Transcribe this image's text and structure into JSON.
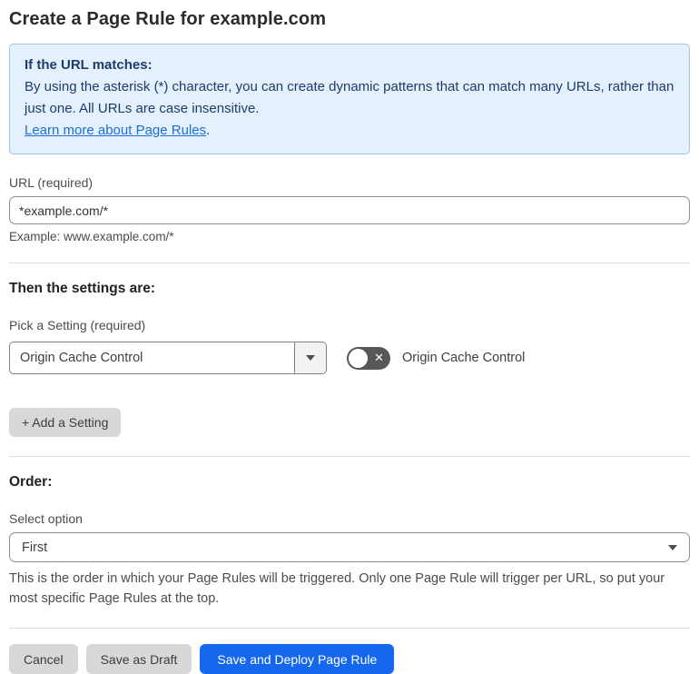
{
  "page": {
    "title": "Create a Page Rule for example.com"
  },
  "info_box": {
    "heading": "If the URL matches:",
    "body": "By using the asterisk (*) character, you can create dynamic patterns that can match many URLs, rather than just one. All URLs are case insensitive.",
    "link_label": "Learn more about Page Rules",
    "link_suffix": "."
  },
  "url_field": {
    "label": "URL (required)",
    "value": "*example.com/*",
    "example": "Example: www.example.com/*"
  },
  "settings_section": {
    "heading": "Then the settings are:",
    "picker_label": "Pick a Setting (required)",
    "picker_value": "Origin Cache Control",
    "toggle_label": "Origin Cache Control",
    "toggle_state": "off",
    "toggle_glyph": "✕",
    "add_setting_label": "+ Add a Setting"
  },
  "order_section": {
    "heading": "Order:",
    "select_label": "Select option",
    "select_value": "First",
    "help_text": "This is the order in which your Page Rules will be triggered. Only one Page Rule will trigger per URL, so put your most specific Page Rules at the top."
  },
  "footer": {
    "cancel_label": "Cancel",
    "save_draft_label": "Save as Draft",
    "save_deploy_label": "Save and Deploy Page Rule"
  },
  "colors": {
    "accent_blue": "#1567ee",
    "info_bg": "#e4f0fb",
    "info_border": "#9ec4ec",
    "info_text": "#1d3c6e",
    "link_blue": "#1d6fd8",
    "toggle_off_bg": "#575757"
  }
}
